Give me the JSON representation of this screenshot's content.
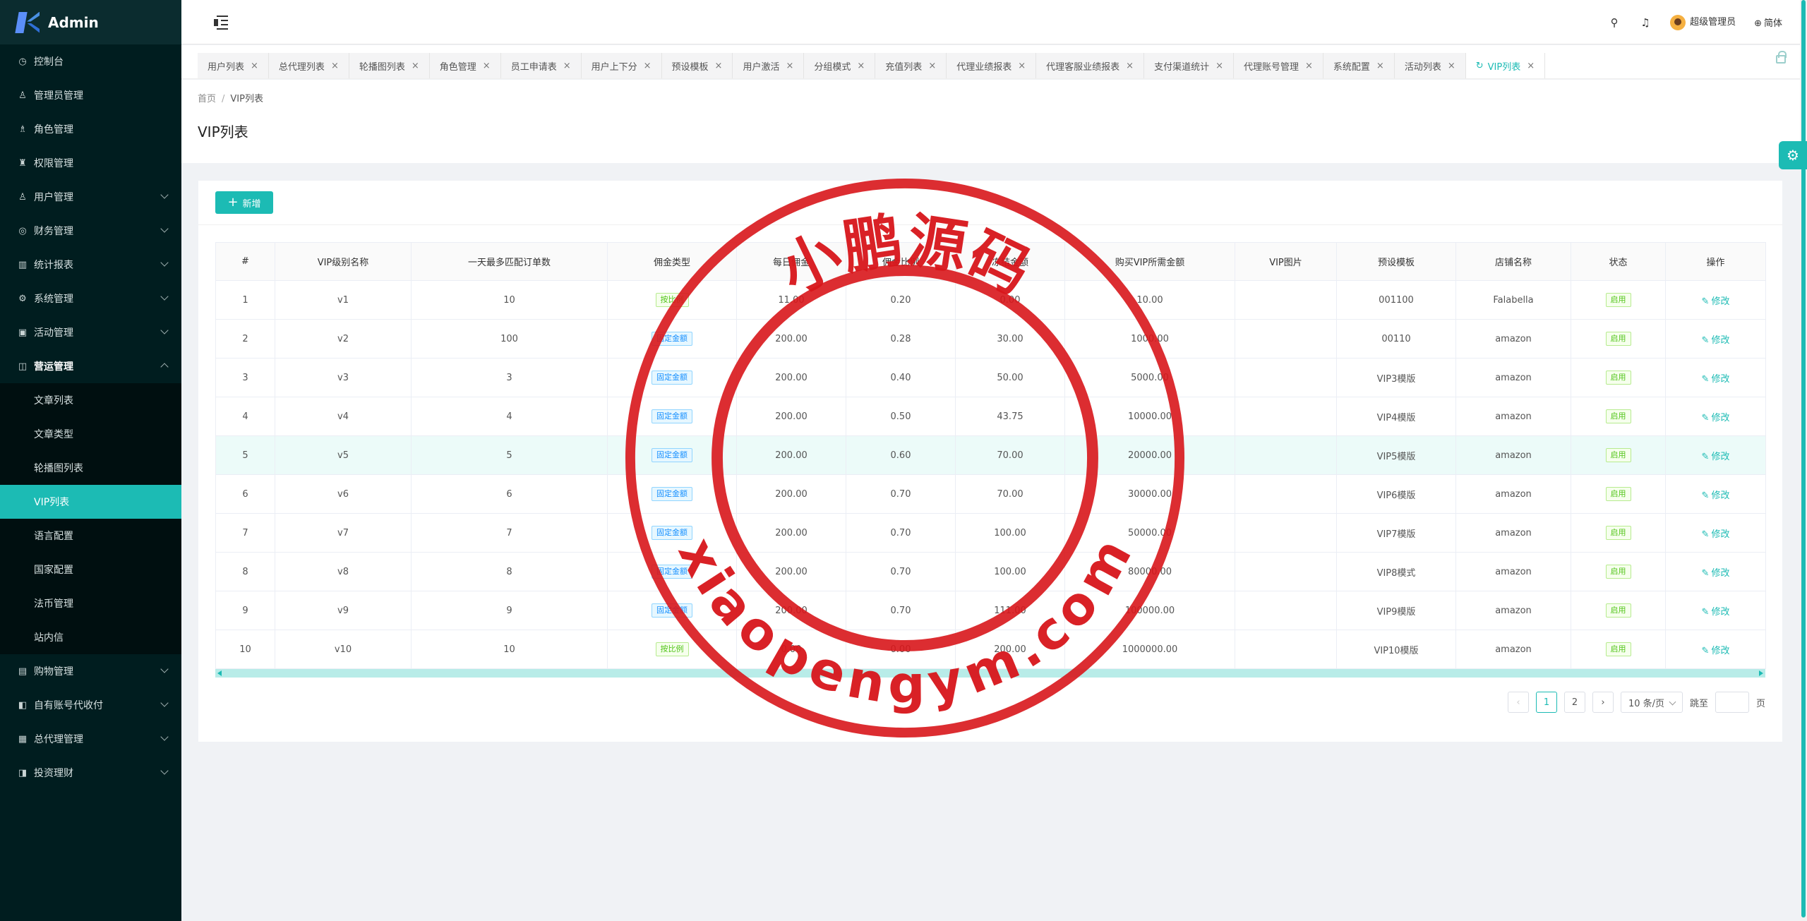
{
  "app": {
    "logo_text": "Admin"
  },
  "sidebar": {
    "items": [
      {
        "label": "控制台",
        "icon": "dashboard-icon",
        "glyph": "◷",
        "has_children": false
      },
      {
        "label": "管理员管理",
        "icon": "user-icon",
        "glyph": "♙",
        "has_children": false
      },
      {
        "label": "角色管理",
        "icon": "role-icon",
        "glyph": "♗",
        "has_children": false
      },
      {
        "label": "权限管理",
        "icon": "permission-icon",
        "glyph": "♜",
        "has_children": false
      },
      {
        "label": "用户管理",
        "icon": "user-icon",
        "glyph": "♙",
        "has_children": true
      },
      {
        "label": "财务管理",
        "icon": "finance-icon",
        "glyph": "◎",
        "has_children": true
      },
      {
        "label": "统计报表",
        "icon": "chart-icon",
        "glyph": "▥",
        "has_children": true
      },
      {
        "label": "系统管理",
        "icon": "gear-icon",
        "glyph": "⚙",
        "has_children": true
      },
      {
        "label": "活动管理",
        "icon": "gift-icon",
        "glyph": "▣",
        "has_children": true
      }
    ],
    "open_group": {
      "label": "营运管理",
      "icon": "operation-icon",
      "glyph": "◫",
      "children": [
        {
          "label": "文章列表",
          "active": false
        },
        {
          "label": "文章类型",
          "active": false
        },
        {
          "label": "轮播图列表",
          "active": false
        },
        {
          "label": "VIP列表",
          "active": true
        },
        {
          "label": "语言配置",
          "active": false
        },
        {
          "label": "国家配置",
          "active": false
        },
        {
          "label": "法币管理",
          "active": false
        },
        {
          "label": "站内信",
          "active": false
        }
      ]
    },
    "items_after": [
      {
        "label": "购物管理",
        "icon": "shopping-icon",
        "glyph": "▤",
        "has_children": true
      },
      {
        "label": "自有账号代收付",
        "icon": "account-icon",
        "glyph": "◧",
        "has_children": true
      },
      {
        "label": "总代理管理",
        "icon": "agent-icon",
        "glyph": "▦",
        "has_children": true
      },
      {
        "label": "投资理财",
        "icon": "invest-icon",
        "glyph": "◨",
        "has_children": true
      }
    ]
  },
  "header": {
    "user_name": "超级管理员",
    "language": "简体"
  },
  "tabs": [
    "用户列表",
    "总代理列表",
    "轮播图列表",
    "角色管理",
    "员工申请表",
    "用户上下分",
    "预设模板",
    "用户激活",
    "分组模式",
    "充值列表",
    "代理业绩报表",
    "代理客服业绩报表",
    "支付渠道统计",
    "代理账号管理",
    "系统配置",
    "活动列表"
  ],
  "active_tab": "VIP列表",
  "breadcrumb": {
    "home": "首页",
    "separator": "/",
    "current": "VIP列表"
  },
  "page_title": "VIP列表",
  "toolbar": {
    "add_label": "新增"
  },
  "table": {
    "columns": [
      "#",
      "VIP级别名称",
      "一天最多匹配订单数",
      "佣金类型",
      "每日佣金",
      "佣金比例",
      "冻结金额",
      "购买VIP所需金额",
      "VIP图片",
      "预设模板",
      "店铺名称",
      "状态",
      "操作"
    ],
    "rows": [
      {
        "idx": "1",
        "name": "v1",
        "max_orders": "10",
        "commission_type": "按比例",
        "type_color": "green",
        "daily": "11.00",
        "ratio": "0.20",
        "frozen": "0.00",
        "price": "10.00",
        "image": "",
        "template": "001100",
        "shop": "Falabella",
        "status": "启用",
        "action": "修改",
        "highlight": false
      },
      {
        "idx": "2",
        "name": "v2",
        "max_orders": "100",
        "commission_type": "固定金额",
        "type_color": "blue",
        "daily": "200.00",
        "ratio": "0.28",
        "frozen": "30.00",
        "price": "1000.00",
        "image": "",
        "template": "00110",
        "shop": "amazon",
        "status": "启用",
        "action": "修改",
        "highlight": false
      },
      {
        "idx": "3",
        "name": "v3",
        "max_orders": "3",
        "commission_type": "固定金额",
        "type_color": "blue",
        "daily": "200.00",
        "ratio": "0.40",
        "frozen": "50.00",
        "price": "5000.00",
        "image": "",
        "template": "VIP3模版",
        "shop": "amazon",
        "status": "启用",
        "action": "修改",
        "highlight": false
      },
      {
        "idx": "4",
        "name": "v4",
        "max_orders": "4",
        "commission_type": "固定金额",
        "type_color": "blue",
        "daily": "200.00",
        "ratio": "0.50",
        "frozen": "43.75",
        "price": "10000.00",
        "image": "",
        "template": "VIP4模版",
        "shop": "amazon",
        "status": "启用",
        "action": "修改",
        "highlight": false
      },
      {
        "idx": "5",
        "name": "v5",
        "max_orders": "5",
        "commission_type": "固定金额",
        "type_color": "blue",
        "daily": "200.00",
        "ratio": "0.60",
        "frozen": "70.00",
        "price": "20000.00",
        "image": "",
        "template": "VIP5模版",
        "shop": "amazon",
        "status": "启用",
        "action": "修改",
        "highlight": true
      },
      {
        "idx": "6",
        "name": "v6",
        "max_orders": "6",
        "commission_type": "固定金额",
        "type_color": "blue",
        "daily": "200.00",
        "ratio": "0.70",
        "frozen": "70.00",
        "price": "30000.00",
        "image": "",
        "template": "VIP6模版",
        "shop": "amazon",
        "status": "启用",
        "action": "修改",
        "highlight": false
      },
      {
        "idx": "7",
        "name": "v7",
        "max_orders": "7",
        "commission_type": "固定金额",
        "type_color": "blue",
        "daily": "200.00",
        "ratio": "0.70",
        "frozen": "100.00",
        "price": "50000.00",
        "image": "",
        "template": "VIP7模版",
        "shop": "amazon",
        "status": "启用",
        "action": "修改",
        "highlight": false
      },
      {
        "idx": "8",
        "name": "v8",
        "max_orders": "8",
        "commission_type": "固定金额",
        "type_color": "blue",
        "daily": "200.00",
        "ratio": "0.70",
        "frozen": "100.00",
        "price": "80000.00",
        "image": "",
        "template": "VIP8模式",
        "shop": "amazon",
        "status": "启用",
        "action": "修改",
        "highlight": false
      },
      {
        "idx": "9",
        "name": "v9",
        "max_orders": "9",
        "commission_type": "固定金额",
        "type_color": "blue",
        "daily": "200.00",
        "ratio": "0.70",
        "frozen": "111.00",
        "price": "100000.00",
        "image": "",
        "template": "VIP9模版",
        "shop": "amazon",
        "status": "启用",
        "action": "修改",
        "highlight": false
      },
      {
        "idx": "10",
        "name": "v10",
        "max_orders": "10",
        "commission_type": "按比例",
        "type_color": "green",
        "daily": "0.00",
        "ratio": "0.00",
        "frozen": "200.00",
        "price": "1000000.00",
        "image": "",
        "template": "VIP10模版",
        "shop": "amazon",
        "status": "启用",
        "action": "修改",
        "highlight": false
      }
    ]
  },
  "pagination": {
    "pages": [
      "1",
      "2"
    ],
    "current": "1",
    "page_size": "10 条/页",
    "jump_label": "跳至",
    "page_suffix": "页"
  },
  "watermark": {
    "top_text": "小鹏源码",
    "bottom_text": "xiaopengym.com",
    "color": "#d8161b"
  },
  "colors": {
    "accent": "#1cbbb4",
    "sidebar_bg": "#001d1f"
  }
}
